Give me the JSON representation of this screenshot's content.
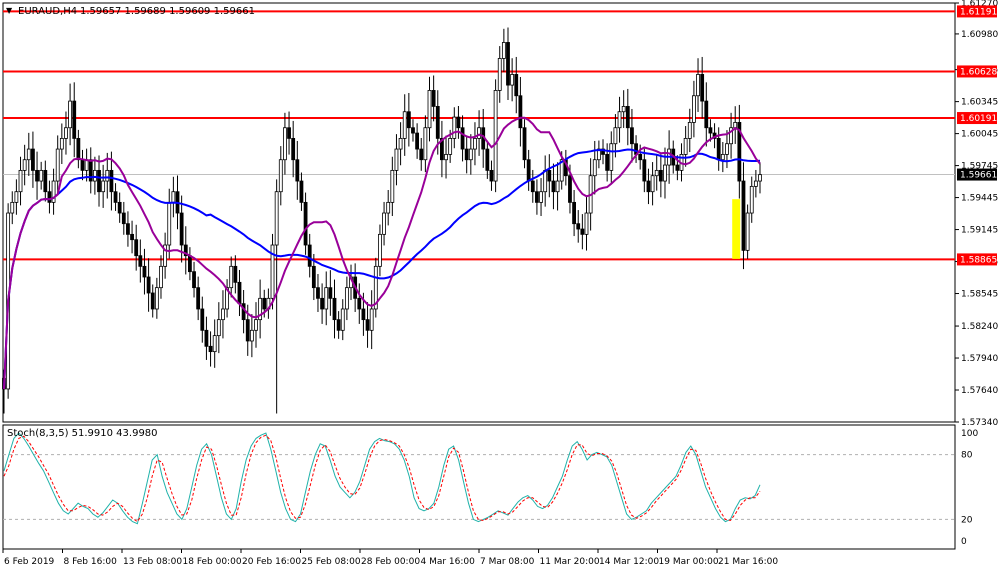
{
  "header": {
    "symbol_label": "EURAUD,H4",
    "ohlc_label": "1.59657 1.59689 1.59609 1.59661"
  },
  "indicator": {
    "label": "Stoch(8,3,5) 51.9910 43.9980",
    "levels": [
      "100",
      "80",
      "20",
      "0"
    ]
  },
  "colors": {
    "background": "#ffffff",
    "candle": "#000000",
    "resistance_line": "#ff0000",
    "price_tag_bg": "#ff0000",
    "current_tag_bg": "#000000",
    "ma_fast": "#990099",
    "ma_slow": "#0000ff",
    "highlight": "#ffff00",
    "stoch_main": "#20b2aa",
    "stoch_signal": "#ff0000"
  },
  "price_axis": [
    "1.61270",
    "1.60980",
    "1.60645",
    "1.60345",
    "1.60045",
    "1.59745",
    "1.59445",
    "1.59145",
    "1.58845",
    "1.58545",
    "1.58240",
    "1.57940",
    "1.57640",
    "1.57340"
  ],
  "price_range": [
    1.5734,
    1.6127
  ],
  "level_lines": [
    "1.61191",
    "1.60628",
    "1.60191",
    "1.58865"
  ],
  "current_price": "1.59661",
  "time_axis": [
    "6 Feb 2019",
    "8 Feb 16:00",
    "13 Feb 08:00",
    "18 Feb 00:00",
    "20 Feb 16:00",
    "25 Feb 08:00",
    "28 Feb 00:00",
    "4 Mar 16:00",
    "7 Mar 08:00",
    "11 Mar 20:00",
    "14 Mar 12:00",
    "19 Mar 00:00",
    "21 Mar 16:00"
  ],
  "chart_data": {
    "type": "candlestick",
    "ylim": [
      1.5734,
      1.6127
    ],
    "closes": [
      1.5765,
      1.593,
      1.594,
      1.595,
      1.597,
      1.598,
      1.599,
      1.597,
      1.596,
      1.597,
      1.595,
      1.594,
      1.596,
      1.599,
      1.6,
      1.601,
      1.6035,
      1.6,
      1.598,
      1.597,
      1.598,
      1.596,
      1.597,
      1.595,
      1.596,
      1.597,
      1.595,
      1.594,
      1.593,
      1.592,
      1.591,
      1.5905,
      1.589,
      1.588,
      1.587,
      1.5855,
      1.584,
      1.586,
      1.588,
      1.59,
      1.594,
      1.595,
      1.593,
      1.59,
      1.589,
      1.5875,
      1.586,
      1.584,
      1.582,
      1.5805,
      1.58,
      1.5815,
      1.583,
      1.584,
      1.586,
      1.588,
      1.5865,
      1.5845,
      1.583,
      1.581,
      1.582,
      1.583,
      1.585,
      1.584,
      1.585,
      1.59,
      1.595,
      1.598,
      1.601,
      1.6,
      1.598,
      1.596,
      1.594,
      1.59,
      1.588,
      1.586,
      1.585,
      1.584,
      1.586,
      1.585,
      1.583,
      1.582,
      1.584,
      1.586,
      1.587,
      1.585,
      1.584,
      1.583,
      1.582,
      1.584,
      1.588,
      1.591,
      1.593,
      1.594,
      1.597,
      1.599,
      1.6,
      1.6025,
      1.601,
      1.6005,
      1.599,
      1.598,
      1.601,
      1.6045,
      1.603,
      1.6,
      1.598,
      1.5985,
      1.6,
      1.602,
      1.601,
      1.599,
      1.598,
      1.599,
      1.6,
      1.601,
      1.599,
      1.597,
      1.596,
      1.6045,
      1.6075,
      1.609,
      1.605,
      1.606,
      1.604,
      1.601,
      1.598,
      1.596,
      1.595,
      1.594,
      1.595,
      1.597,
      1.596,
      1.595,
      1.596,
      1.598,
      1.5965,
      1.594,
      1.592,
      1.5915,
      1.591,
      1.593,
      1.5965,
      1.598,
      1.599,
      1.5985,
      1.597,
      1.5995,
      1.601,
      1.6025,
      1.603,
      1.601,
      1.5995,
      1.5985,
      1.598,
      1.596,
      1.595,
      1.5965,
      1.597,
      1.596,
      1.5975,
      1.599,
      1.5975,
      1.597,
      1.5985,
      1.6,
      1.6015,
      1.604,
      1.606,
      1.6035,
      1.601,
      1.6005,
      1.6,
      1.598,
      1.5985,
      1.5995,
      1.601,
      1.6015,
      1.596,
      1.5895,
      1.593,
      1.5955,
      1.596,
      1.5966
    ],
    "highlight_bar_index": 177,
    "levels": [
      1.61191,
      1.60628,
      1.60191,
      1.58865
    ],
    "current": 1.59661,
    "stoch_main": [
      65,
      80,
      95,
      100,
      95,
      88,
      80,
      72,
      65,
      55,
      45,
      35,
      28,
      25,
      30,
      35,
      32,
      30,
      25,
      22,
      26,
      32,
      38,
      35,
      28,
      22,
      18,
      16,
      35,
      55,
      75,
      80,
      60,
      45,
      35,
      25,
      20,
      30,
      50,
      70,
      85,
      90,
      80,
      60,
      40,
      25,
      20,
      30,
      55,
      75,
      88,
      95,
      98,
      100,
      85,
      65,
      45,
      30,
      20,
      18,
      25,
      45,
      65,
      80,
      90,
      88,
      75,
      60,
      50,
      45,
      40,
      45,
      55,
      70,
      85,
      92,
      95,
      93,
      92,
      90,
      85,
      75,
      60,
      40,
      30,
      28,
      30,
      35,
      50,
      70,
      85,
      88,
      75,
      55,
      35,
      20,
      18,
      20,
      22,
      25,
      28,
      26,
      24,
      30,
      36,
      40,
      42,
      38,
      32,
      30,
      33,
      40,
      50,
      60,
      75,
      88,
      92,
      85,
      75,
      80,
      82,
      80,
      78,
      70,
      55,
      40,
      25,
      20,
      22,
      25,
      28,
      35,
      40,
      45,
      50,
      55,
      60,
      70,
      82,
      88,
      80,
      65,
      50,
      40,
      30,
      22,
      18,
      20,
      30,
      38,
      40,
      39,
      42,
      52
    ],
    "stoch_signal": [
      60,
      70,
      85,
      95,
      97,
      92,
      85,
      78,
      70,
      62,
      52,
      42,
      34,
      28,
      28,
      31,
      33,
      32,
      29,
      25,
      24,
      27,
      32,
      35,
      32,
      26,
      21,
      18,
      25,
      40,
      60,
      75,
      73,
      58,
      44,
      32,
      24,
      25,
      38,
      58,
      75,
      87,
      85,
      70,
      52,
      35,
      24,
      24,
      40,
      62,
      80,
      91,
      96,
      98,
      93,
      78,
      58,
      40,
      27,
      21,
      22,
      34,
      52,
      70,
      84,
      89,
      83,
      70,
      58,
      50,
      44,
      43,
      49,
      62,
      77,
      88,
      93,
      94,
      93,
      91,
      88,
      80,
      68,
      52,
      38,
      31,
      29,
      32,
      42,
      60,
      78,
      86,
      82,
      65,
      45,
      28,
      20,
      19,
      21,
      24,
      27,
      27,
      25,
      27,
      32,
      37,
      40,
      40,
      36,
      32,
      31,
      36,
      44,
      54,
      66,
      80,
      89,
      89,
      81,
      79,
      81,
      81,
      79,
      74,
      63,
      48,
      33,
      24,
      21,
      23,
      26,
      31,
      37,
      42,
      47,
      52,
      57,
      65,
      76,
      85,
      84,
      72,
      58,
      46,
      36,
      27,
      20,
      19,
      25,
      33,
      38,
      40,
      40,
      46
    ]
  }
}
